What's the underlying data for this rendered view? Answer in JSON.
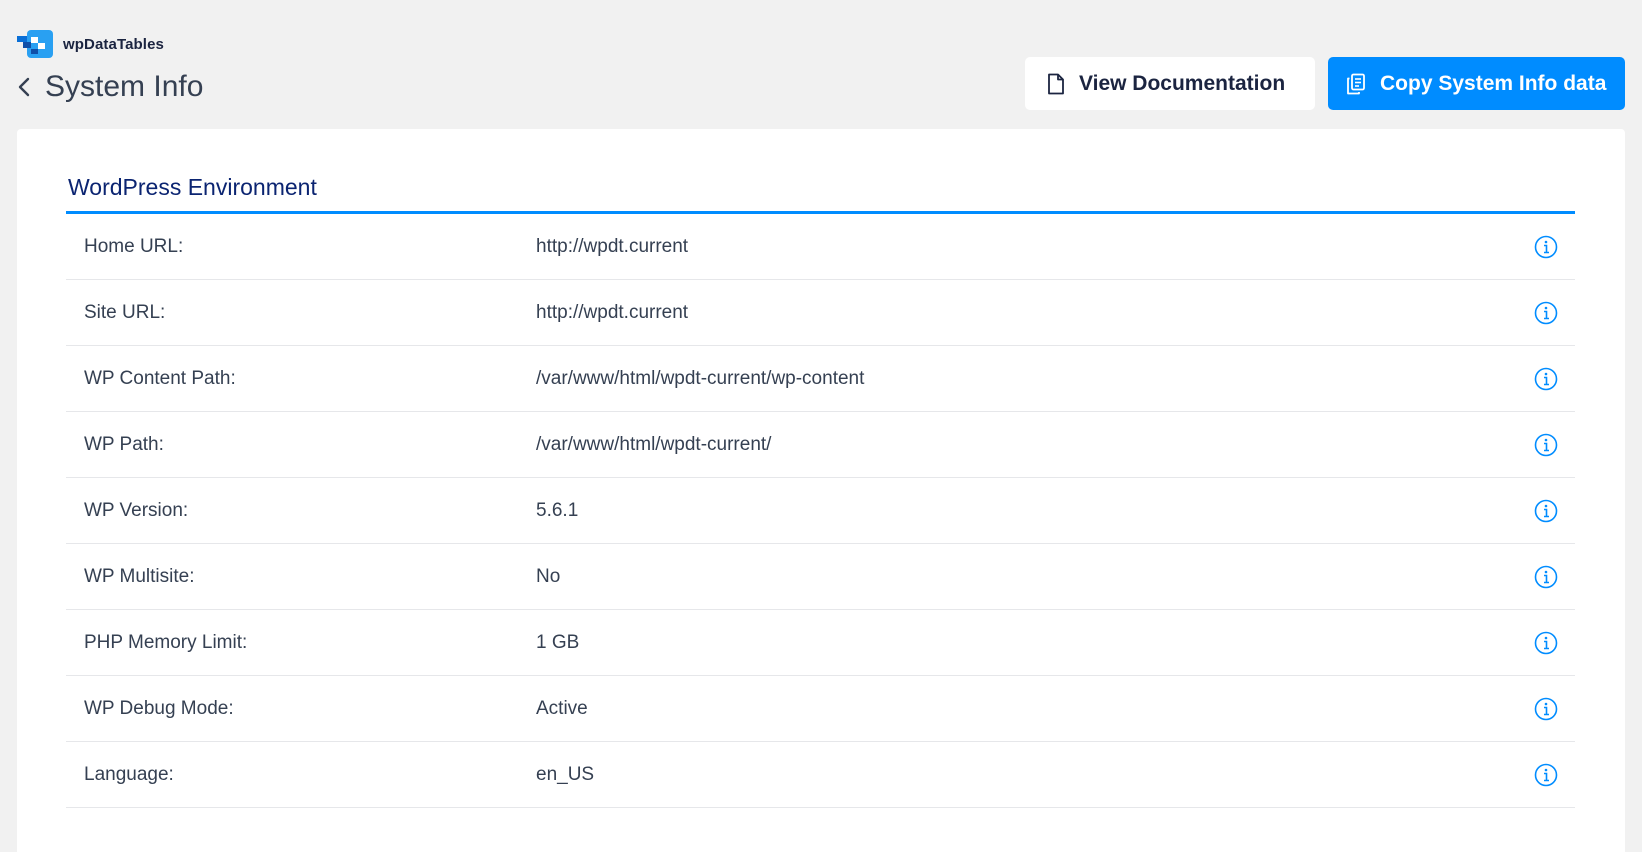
{
  "header": {
    "brand_name": "wpDataTables",
    "page_title": "System Info",
    "view_docs_label": "View Documentation",
    "copy_label": "Copy System Info data"
  },
  "colors": {
    "accent": "#008cff",
    "section_title": "#0b2471",
    "text": "#354052",
    "background": "#f1f1f1"
  },
  "icons": {
    "back": "chevron-left-icon",
    "docs": "document-icon",
    "copy": "copy-icon",
    "info": "info-circle-icon"
  },
  "section": {
    "title": "WordPress Environment",
    "rows": [
      {
        "label": "Home URL:",
        "value": "http://wpdt.current"
      },
      {
        "label": "Site URL:",
        "value": "http://wpdt.current"
      },
      {
        "label": "WP Content Path:",
        "value": "/var/www/html/wpdt-current/wp-content"
      },
      {
        "label": "WP Path:",
        "value": "/var/www/html/wpdt-current/"
      },
      {
        "label": "WP Version:",
        "value": "5.6.1"
      },
      {
        "label": "WP Multisite:",
        "value": "No"
      },
      {
        "label": "PHP Memory Limit:",
        "value": "1 GB"
      },
      {
        "label": "WP Debug Mode:",
        "value": "Active"
      },
      {
        "label": "Language:",
        "value": "en_US"
      }
    ]
  }
}
